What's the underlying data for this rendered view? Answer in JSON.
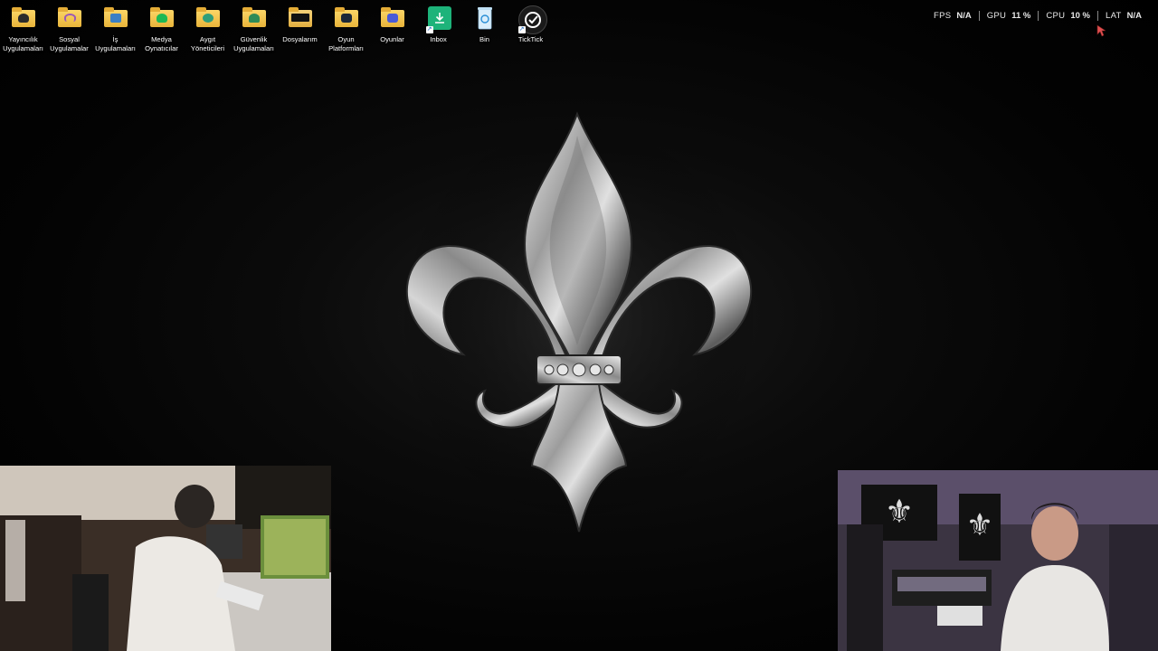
{
  "desktop": {
    "icons": [
      {
        "label": "Yayıncılık Uygulamaları",
        "icon": "streaming-apps-folder-icon",
        "color": "#2b2b2b"
      },
      {
        "label": "Sosyal Uygulamalar",
        "icon": "social-apps-folder-icon",
        "color": "#9b59b6"
      },
      {
        "label": "İş Uygulamaları",
        "icon": "business-apps-folder-icon",
        "color": "#3b7fc4"
      },
      {
        "label": "Medya Oynatıcılar",
        "icon": "media-players-folder-icon",
        "color": "#1db954"
      },
      {
        "label": "Aygıt Yöneticileri",
        "icon": "device-managers-folder-icon",
        "color": "#2f9e7a"
      },
      {
        "label": "Güvenlik Uygulamaları",
        "icon": "security-apps-folder-icon",
        "color": "#2e8b57"
      },
      {
        "label": "Dosyalarım",
        "icon": "my-files-folder-icon",
        "color": "#111111"
      },
      {
        "label": "Oyun Platformları",
        "icon": "game-platforms-folder-icon",
        "color": "#1b2838"
      },
      {
        "label": "Oyunlar",
        "icon": "games-folder-icon",
        "color": "#4a5bd6"
      },
      {
        "label": "Inbox",
        "icon": "inbox-download-icon",
        "color": "#1db37a"
      },
      {
        "label": "Bin",
        "icon": "recycle-bin-icon",
        "color": "#4aa3df"
      },
      {
        "label": "TickTick",
        "icon": "ticktick-app-icon",
        "color": "#1a1a1a"
      }
    ]
  },
  "perf": {
    "fps_label": "FPS",
    "fps_value": "N/A",
    "gpu_label": "GPU",
    "gpu_value": "11 %",
    "cpu_label": "CPU",
    "cpu_value": "10 %",
    "lat_label": "LAT",
    "lat_value": "N/A"
  },
  "wallpaper": {
    "emblem": "fleur-de-lis-emblem",
    "accent": "#c9c9c9"
  },
  "webcams": {
    "left": "room-camera-feed",
    "right": "face-camera-feed"
  }
}
